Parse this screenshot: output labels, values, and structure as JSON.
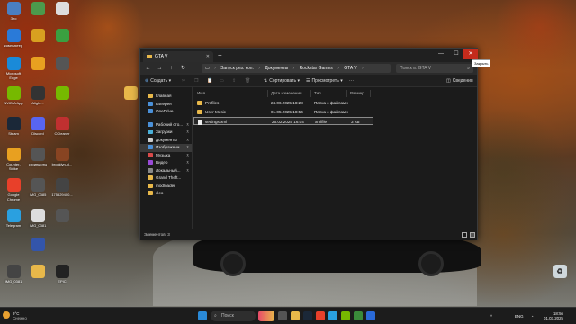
{
  "desktop": {
    "icons": [
      {
        "label": "Это",
        "color": "#4a7fc1"
      },
      {
        "label": "",
        "color": "#4c9a4c"
      },
      {
        "label": "",
        "color": "#dddddd"
      },
      {
        "label": "компьютер",
        "color": "#2a7ad8"
      },
      {
        "label": "",
        "color": "#d8a020"
      },
      {
        "label": "",
        "color": "#3aa040"
      },
      {
        "label": "Microsoft Edge",
        "color": "#1a8ad8"
      },
      {
        "label": "",
        "color": "#e8a020"
      },
      {
        "label": "",
        "color": "#555555"
      },
      {
        "label": "NVIDIA App",
        "color": "#76b900"
      },
      {
        "label": "Alight...",
        "color": "#333333"
      },
      {
        "label": "",
        "color": "#76b900"
      },
      {
        "label": "Steam",
        "color": "#1b2838"
      },
      {
        "label": "Discord",
        "color": "#5865f2"
      },
      {
        "label": "CCleaner",
        "color": "#c03030"
      },
      {
        "label": "Counter-Strike",
        "color": "#e8a020"
      },
      {
        "label": "скриншоты",
        "color": "#555555"
      },
      {
        "label": "brooklyn-ci...",
        "color": "#884422"
      },
      {
        "label": "Google Chrome",
        "color": "#e8402a"
      },
      {
        "label": "IMG_0385",
        "color": "#555555"
      },
      {
        "label": "175529400...",
        "color": "#444444"
      },
      {
        "label": "Telegram",
        "color": "#2aa0e0"
      },
      {
        "label": "IMG_0381",
        "color": "#dddddd"
      },
      {
        "label": "",
        "color": "#555555"
      },
      {
        "label": "",
        "color": "#3355aa"
      },
      {
        "label": "IMG_0381",
        "color": "#444444"
      },
      {
        "label": "",
        "color": "#e8b84a"
      },
      {
        "label": "EPIC",
        "color": "#222222"
      },
      {
        "label": "",
        "color": "#663333"
      }
    ],
    "right_folder_label": "",
    "recycle_bin_label": ""
  },
  "explorer": {
    "tab_title": "GTA V",
    "tab_close": "✕",
    "new_tab": "+",
    "minimize": "—",
    "maximize": "☐",
    "close": "✕",
    "close_tooltip": "Закрыть",
    "breadcrumbs": [
      "Запуск рез. коп.",
      "Документы",
      "Rockstar Games",
      "GTA V"
    ],
    "search_placeholder": "Поиск в: GTA V",
    "commands": {
      "create": "Создать",
      "sort": "Сортировать",
      "view": "Просмотреть",
      "more": "···",
      "details": "Сведения"
    },
    "sidebar": [
      {
        "label": "Главная",
        "color": "#e8b84a",
        "pinned": false
      },
      {
        "label": "Галерея",
        "color": "#4a90d8",
        "pinned": false
      },
      {
        "label": "OneDrive",
        "color": "#4a90d8",
        "pinned": false
      },
      {
        "label": "",
        "color": "transparent",
        "pinned": false
      },
      {
        "label": "Рабочий сто...",
        "color": "#4a90d8",
        "pinned": true
      },
      {
        "label": "Загрузки",
        "color": "#4ab0d8",
        "pinned": true
      },
      {
        "label": "Документы",
        "color": "#cccccc",
        "pinned": true
      },
      {
        "label": "Изображени...",
        "color": "#4a90d8",
        "pinned": true
      },
      {
        "label": "Музыка",
        "color": "#d84a4a",
        "pinned": true
      },
      {
        "label": "Видео",
        "color": "#9a4ad8",
        "pinned": true
      },
      {
        "label": "Локальный...",
        "color": "#888888",
        "pinned": true
      },
      {
        "label": "Grand Theft...",
        "color": "#e8b84a",
        "pinned": false
      },
      {
        "label": "modloader",
        "color": "#e8b84a",
        "pinned": false
      },
      {
        "label": "cleo",
        "color": "#e8b84a",
        "pinned": false
      }
    ],
    "columns": {
      "name": "Имя",
      "date": "Дата изменения",
      "type": "Тип",
      "size": "Размер"
    },
    "files": [
      {
        "name": "Profiles",
        "date": "24.06.2025 18:28",
        "type": "Папка с файлами",
        "size": "",
        "kind": "folder"
      },
      {
        "name": "User Music",
        "date": "01.05.2025 18:54",
        "type": "Папка с файлами",
        "size": "",
        "kind": "folder"
      },
      {
        "name": "settings.xml",
        "date": "26.02.2025 16:04",
        "type": "xmlfile",
        "size": "3 КБ",
        "kind": "file"
      }
    ],
    "status": "Элементов: 3"
  },
  "taskbar": {
    "weather_temp": "9°C",
    "weather_text": "Снежно",
    "search_placeholder": "Поиск",
    "lang": "ENG",
    "time": "18:56",
    "date": "01.03.2025"
  }
}
